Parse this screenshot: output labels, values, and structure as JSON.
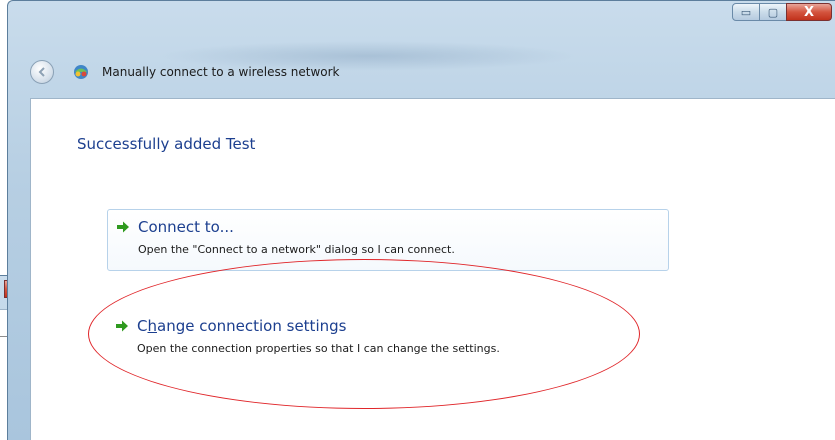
{
  "window": {
    "title": "Manually connect to a wireless network",
    "caption_buttons": {
      "minimize": "▭",
      "maximize": "▢",
      "close": "X"
    }
  },
  "nav": {
    "back_icon": "back-arrow-icon"
  },
  "content": {
    "heading": "Successfully added Test",
    "options": [
      {
        "title_prefix": "Connect to...",
        "title_underlined": "",
        "title_rest": "",
        "description": "Open the \"Connect to a network\" dialog so I can connect."
      },
      {
        "title_prefix": "C",
        "title_underlined": "h",
        "title_rest": "ange connection settings",
        "description": "Open the connection properties so that I can change the settings."
      }
    ]
  },
  "background_window": {
    "close_label": "X"
  },
  "colors": {
    "link_blue": "#1c3f8f",
    "highlight_red": "#e0262a",
    "arrow_green": "#2f9a1f"
  }
}
